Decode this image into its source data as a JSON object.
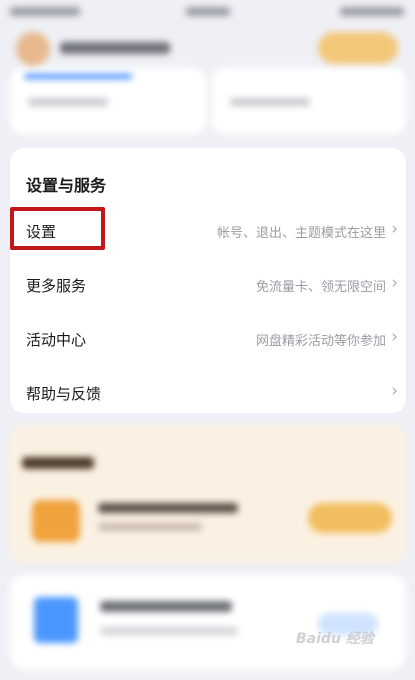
{
  "services": {
    "title": "设置与服务",
    "items": [
      {
        "label": "设置",
        "desc": "帐号、退出、主题模式在这里"
      },
      {
        "label": "更多服务",
        "desc": "免流量卡、领无限空间"
      },
      {
        "label": "活动中心",
        "desc": "网盘精彩活动等你参加"
      },
      {
        "label": "帮助与反馈",
        "desc": ""
      }
    ],
    "chevron": "›"
  },
  "highlight": {
    "target": "设置",
    "color": "#c2171b"
  },
  "watermark": "Baidu 经验",
  "colors": {
    "background": "#eef0f5",
    "card": "#ffffff",
    "accent_blue": "#3e8dff",
    "vip_gold": "#f3c778"
  }
}
